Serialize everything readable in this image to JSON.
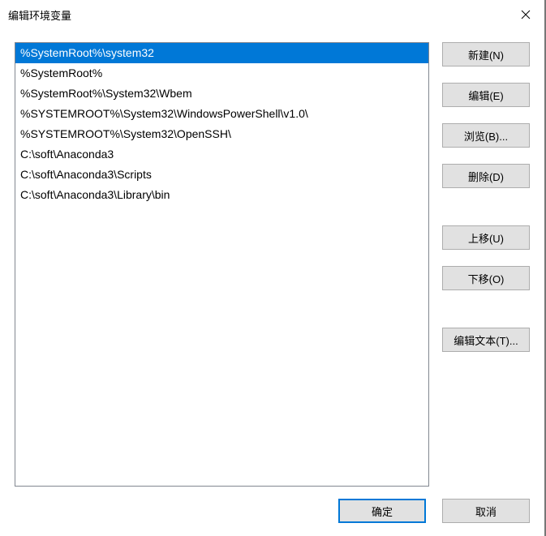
{
  "title": "编辑环境变量",
  "items": [
    "%SystemRoot%\\system32",
    "%SystemRoot%",
    "%SystemRoot%\\System32\\Wbem",
    "%SYSTEMROOT%\\System32\\WindowsPowerShell\\v1.0\\",
    "%SYSTEMROOT%\\System32\\OpenSSH\\",
    "C:\\soft\\Anaconda3",
    "C:\\soft\\Anaconda3\\Scripts",
    "C:\\soft\\Anaconda3\\Library\\bin"
  ],
  "selected_index": 0,
  "buttons": {
    "new": "新建(N)",
    "edit": "编辑(E)",
    "browse": "浏览(B)...",
    "delete": "删除(D)",
    "moveup": "上移(U)",
    "movedown": "下移(O)",
    "edittext": "编辑文本(T)..."
  },
  "footer": {
    "ok": "确定",
    "cancel": "取消"
  }
}
